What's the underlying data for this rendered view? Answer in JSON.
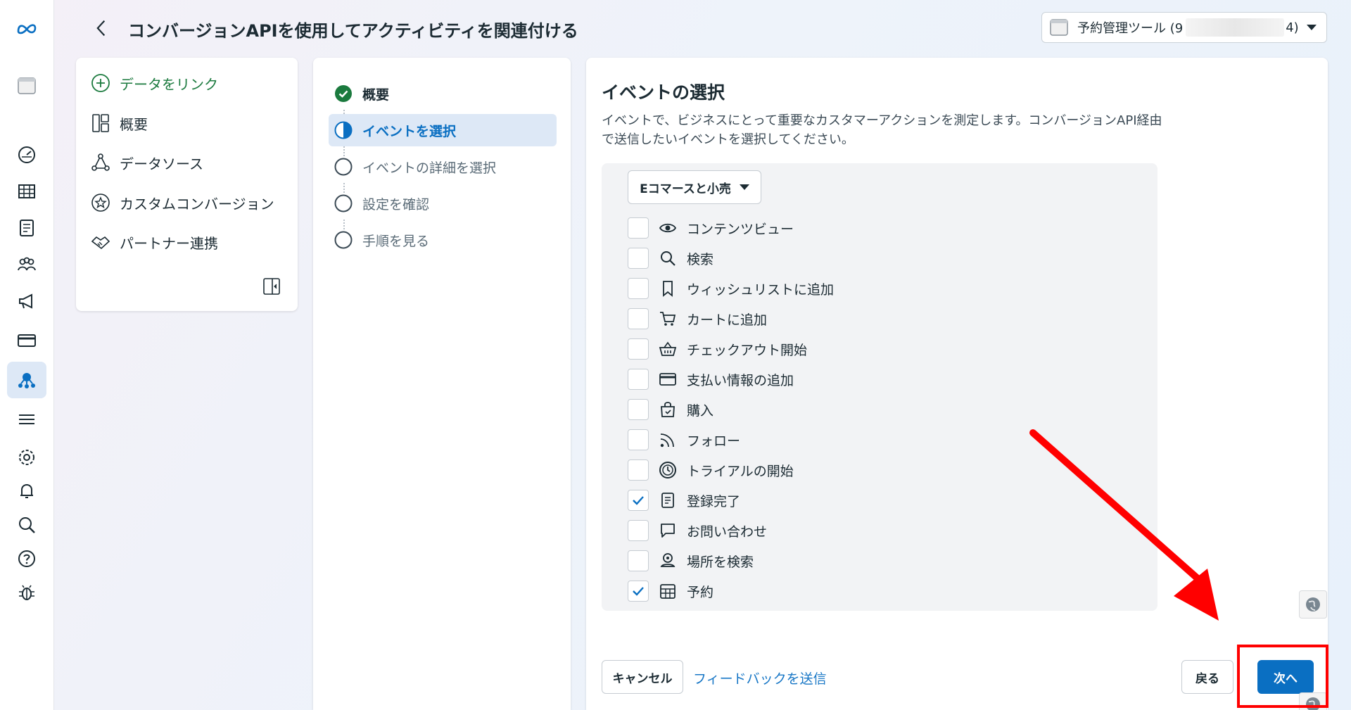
{
  "header": {
    "title": "コンバージョンAPIを使用してアクティビティを関連付ける",
    "asset_selector": {
      "label": "予約管理ツール (9",
      "tail": "4)"
    }
  },
  "left_nav": {
    "items": [
      {
        "label": "データをリンク",
        "icon": "plus-circle-icon"
      },
      {
        "label": "概要",
        "icon": "dashboard-layout-icon"
      },
      {
        "label": "データソース",
        "icon": "network-nodes-icon"
      },
      {
        "label": "カスタムコンバージョン",
        "icon": "star-circle-icon"
      },
      {
        "label": "パートナー連携",
        "icon": "handshake-icon"
      }
    ]
  },
  "steps": [
    {
      "label": "概要",
      "state": "done"
    },
    {
      "label": "イベントを選択",
      "state": "active"
    },
    {
      "label": "イベントの詳細を選択",
      "state": "todo"
    },
    {
      "label": "設定を確認",
      "state": "todo"
    },
    {
      "label": "手順を見る",
      "state": "todo"
    }
  ],
  "main": {
    "title": "イベントの選択",
    "description": "イベントで、ビジネスにとって重要なカスタマーアクションを測定します。コンバージョンAPI経由で送信したいイベントを選択してください。",
    "category": "Eコマースと小売",
    "events": [
      {
        "label": "コンテンツビュー",
        "icon": "eye-icon",
        "checked": false
      },
      {
        "label": "検索",
        "icon": "search-icon",
        "checked": false
      },
      {
        "label": "ウィッシュリストに追加",
        "icon": "bookmark-icon",
        "checked": false
      },
      {
        "label": "カートに追加",
        "icon": "cart-icon",
        "checked": false
      },
      {
        "label": "チェックアウト開始",
        "icon": "basket-icon",
        "checked": false
      },
      {
        "label": "支払い情報の追加",
        "icon": "credit-card-icon",
        "checked": false
      },
      {
        "label": "購入",
        "icon": "shopping-bag-icon",
        "checked": false
      },
      {
        "label": "フォロー",
        "icon": "rss-icon",
        "checked": false
      },
      {
        "label": "トライアルの開始",
        "icon": "clock-icon",
        "checked": false
      },
      {
        "label": "登録完了",
        "icon": "form-icon",
        "checked": true
      },
      {
        "label": "お問い合わせ",
        "icon": "chat-bubble-icon",
        "checked": false
      },
      {
        "label": "場所を検索",
        "icon": "location-pin-icon",
        "checked": false
      },
      {
        "label": "予約",
        "icon": "calendar-grid-icon",
        "checked": true
      }
    ],
    "footer": {
      "cancel": "キャンセル",
      "feedback": "フィードバックを送信",
      "back": "戻る",
      "next": "次へ"
    }
  },
  "colors": {
    "accent": "#0a6fc2",
    "link_green": "#1b7a3e",
    "highlight_red": "#ff0000",
    "active_bg": "#dde8f6"
  }
}
